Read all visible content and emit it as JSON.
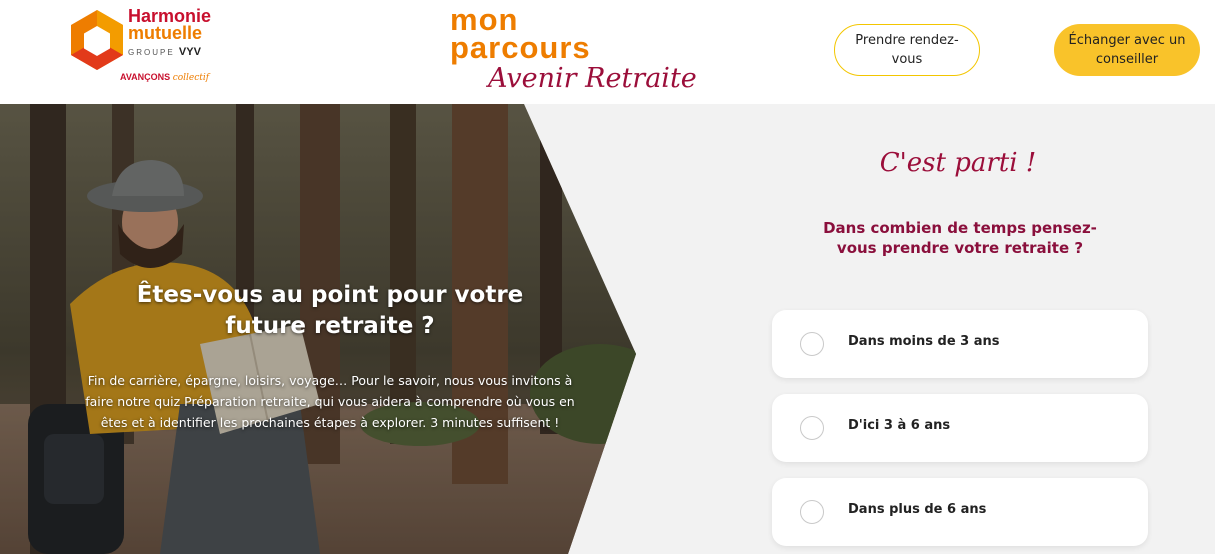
{
  "header": {
    "logo": {
      "line1": "Harmonie",
      "line2": "mutuelle",
      "group_prefix": "GROUPE",
      "group_name": "VYV",
      "tagline_main": "AVANÇONS",
      "tagline_script": "collectif"
    },
    "brand": {
      "word1": "mon",
      "word2": "parcours",
      "word3": "Avenir Retraite"
    },
    "rdv_button": "Prendre rendez-vous",
    "advisor_button": "Échanger avec un conseiller"
  },
  "hero": {
    "title": "Êtes-vous au point pour votre future retraite ?",
    "description": "Fin de carrière, épargne, loisirs, voyage… Pour le savoir, nous vous invitons à faire notre quiz Préparation retraite, qui vous aidera à comprendre où vous en êtes et à identifier les prochaines étapes à explorer. 3 minutes suffisent !"
  },
  "quiz": {
    "kicker": "C'est parti !",
    "question": "Dans combien de temps pensez-vous prendre votre retraite ?",
    "options": [
      {
        "label": "Dans moins de 3 ans"
      },
      {
        "label": "D'ici 3 à 6 ans"
      },
      {
        "label": "Dans plus de 6 ans"
      }
    ]
  },
  "colors": {
    "brand_orange": "#ee7d00",
    "brand_red": "#c8102e",
    "burgundy": "#8a0f3c",
    "button_yellow": "#f9c32a"
  }
}
